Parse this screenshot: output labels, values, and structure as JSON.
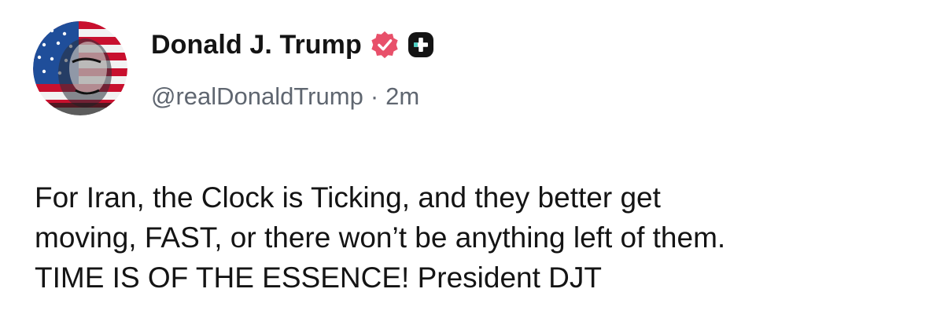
{
  "author": {
    "display_name": "Donald J. Trump",
    "handle": "@realDonaldTrump",
    "separator": "·",
    "timestamp": "2m",
    "avatar_icon": "flag-portrait-avatar",
    "verified_icon": "verified-badge-icon",
    "plus_icon": "plus-badge-icon"
  },
  "post": {
    "lines": [
      "For Iran, the Clock is Ticking, and they better get",
      "moving, FAST, or there won’t be anything left of them.",
      "TIME IS OF THE ESSENCE! President DJT"
    ]
  },
  "colors": {
    "verified": "#e8506a",
    "text": "#141414",
    "muted": "#5f6670",
    "plus_badge": "#141414"
  }
}
